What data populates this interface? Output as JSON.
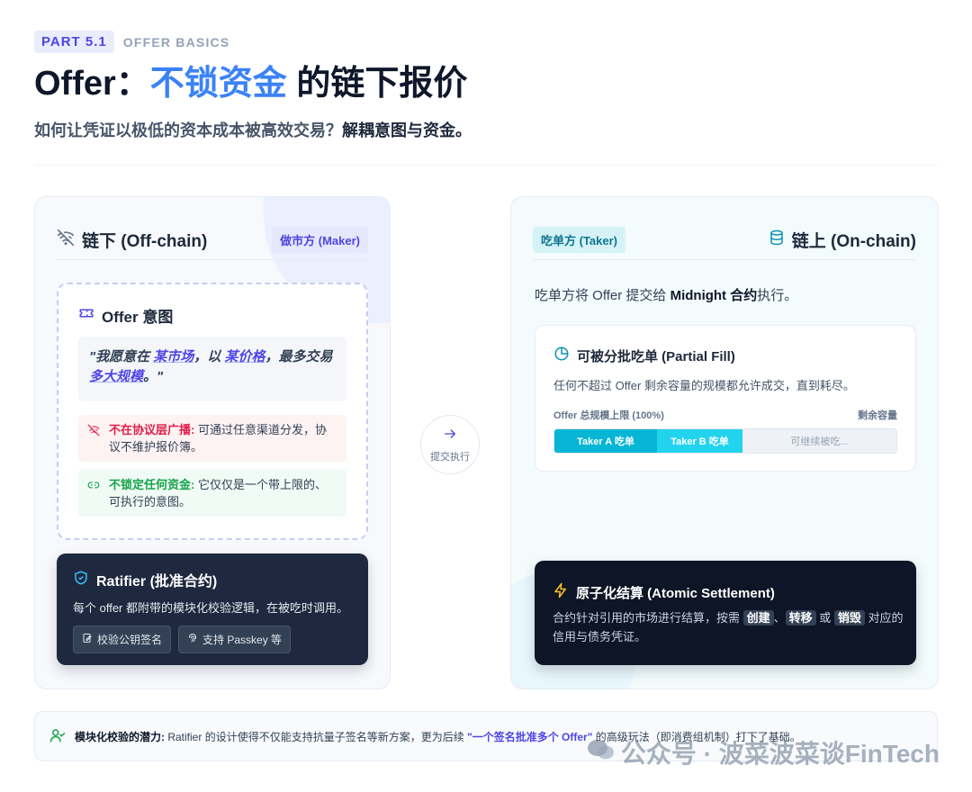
{
  "header": {
    "part_label": "PART 5.1",
    "part_subtitle": "OFFER BASICS",
    "title_prefix": "Offer：",
    "title_accent": "不锁资金",
    "title_suffix": " 的链下报价",
    "subtitle_plain": "如何让凭证以极低的资本成本被高效交易？",
    "subtitle_bold": "解耦意图与资金。"
  },
  "left_panel": {
    "title": "链下 (Off-chain)",
    "role_badge": "做市方 (Maker)",
    "intent": {
      "title": "Offer 意图",
      "quote_1": "\"我愿意在 ",
      "quote_hl_1": "某市场",
      "quote_2": "，以 ",
      "quote_hl_2": "某价格",
      "quote_3": "，最多交易 ",
      "quote_hl_3": "多大规模",
      "quote_4": "。\"",
      "note_red_key": "不在协议层广播:",
      "note_red_text": " 可通过任意渠道分发，协议不维护报价簿。",
      "note_green_key": "不锁定任何资金:",
      "note_green_text": " 它仅仅是一个带上限的、可执行的意图。"
    },
    "ratifier": {
      "title": "Ratifier (批准合约)",
      "desc": "每个 offer 都附带的模块化校验逻辑，在被吃时调用。",
      "chip_1": "校验公钥签名",
      "chip_2": "支持 Passkey 等"
    }
  },
  "exec_label": "提交执行",
  "right_panel": {
    "title": "链上 (On-chain)",
    "role_badge": "吃单方 (Taker)",
    "desc_1": "吃单方将 Offer 提交给 ",
    "desc_bold": "Midnight 合约",
    "desc_2": "执行。",
    "fill": {
      "title": "可被分批吃单 (Partial Fill)",
      "desc": "任何不超过 Offer 剩余容量的规模都允许成交，直到耗尽。",
      "label_left": "Offer 总规模上限 (100%)",
      "label_right": "剩余容量",
      "seg_a": "Taker A 吃单",
      "seg_b": "Taker B 吃单",
      "seg_rest": "可继续被吃...",
      "seg_a_fraction": 0.3,
      "seg_b_fraction": 0.25
    },
    "atomic": {
      "title": "原子化结算 (Atomic Settlement)",
      "desc_1": "合约针对引用的市场进行结算，按需 ",
      "k1": "创建",
      "sep1": "、",
      "k2": "转移",
      "sep2": " 或 ",
      "k3": "销毁",
      "desc_2": " 对应的信用与债务凭证。"
    }
  },
  "footer": {
    "label": "模块化校验的潜力:",
    "text_1": "Ratifier 的设计使得不仅能支持抗量子签名等新方案，更为后续 ",
    "highlight": "\"一个签名批准多个 Offer\"",
    "text_2": " 的高级玩法（即消费组机制）打下了基础。"
  },
  "watermark": "公众号 · 波菜波菜谈FinTech",
  "colors": {
    "accent_blue": "#3b82f6",
    "indigo": "#4f46e5",
    "cyan": "#06b6d4",
    "dark_card": "#1e2940",
    "red": "#e11d48",
    "green": "#16a34a"
  }
}
